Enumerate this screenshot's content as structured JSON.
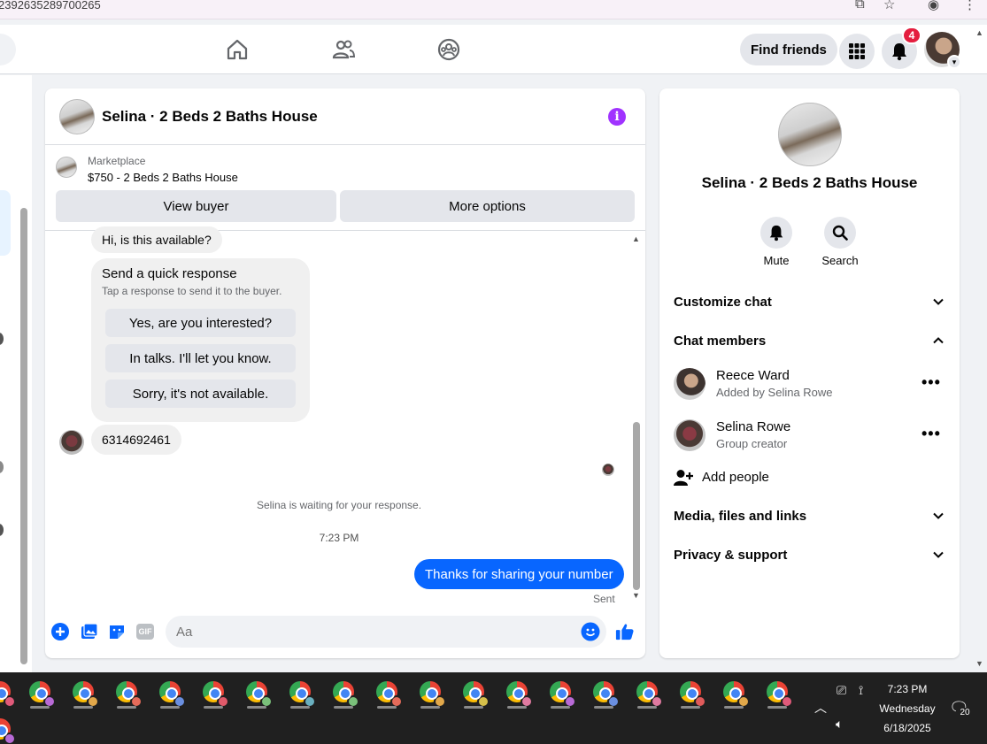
{
  "browser": {
    "url_fragment": "2392635289700265"
  },
  "topnav": {
    "find_friends_label": "Find friends",
    "notification_count": "4"
  },
  "chat": {
    "title": "Selina · 2 Beds 2 Baths House",
    "marketplace_label": "Marketplace",
    "listing_price_title": "$750 - 2 Beds 2 Baths House",
    "view_buyer_label": "View buyer",
    "more_options_label": "More options",
    "messages": {
      "first_message": "Hi, is this available?",
      "quick_response_title": "Send a quick response",
      "quick_response_subtitle": "Tap a response to send it to the buyer.",
      "quick_responses": [
        "Yes, are you interested?",
        "In talks. I'll let you know.",
        "Sorry, it's not available."
      ],
      "phone_message": "6314692461",
      "waiting_notice": "Selina is waiting for your response.",
      "timestamp": "7:23 PM",
      "my_message": "Thanks for sharing your number",
      "sent_status": "Sent"
    },
    "composer": {
      "placeholder": "Aa",
      "gif_label": "GIF"
    }
  },
  "details": {
    "title": "Selina · 2 Beds 2 Baths House",
    "mute_label": "Mute",
    "search_label": "Search",
    "customize_chat_label": "Customize chat",
    "chat_members_label": "Chat members",
    "members": [
      {
        "name": "Reece Ward",
        "subtitle": "Added by Selina Rowe"
      },
      {
        "name": "Selina Rowe",
        "subtitle": "Group creator"
      }
    ],
    "add_people_label": "Add people",
    "media_label": "Media, files and links",
    "privacy_label": "Privacy & support"
  },
  "taskbar": {
    "time": "7:23 PM",
    "day": "Wednesday",
    "date": "6/18/2025",
    "notification_count": "20"
  },
  "colors": {
    "accent_blue": "#0866ff",
    "info_purple": "#a033ff",
    "badge_red": "#e41e3f"
  }
}
